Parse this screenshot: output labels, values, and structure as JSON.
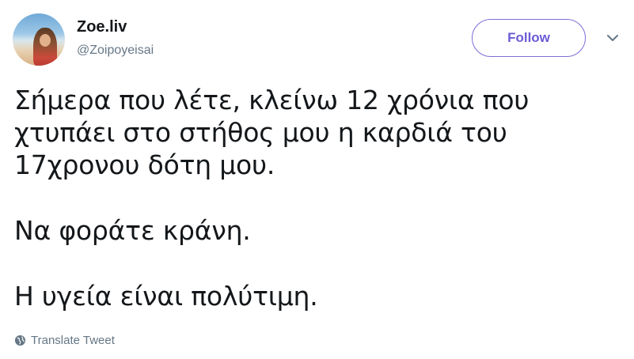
{
  "author": {
    "name": "Zoe.liv",
    "handle": "@Zoipoyeisai"
  },
  "follow_button": {
    "label": "Follow"
  },
  "menu_caret": {
    "icon": "chevron-down-icon"
  },
  "tweet": {
    "lines": [
      "Σήμερα που λέτε, κλείνω 12 χρόνια που",
      "χτυπάει στο στήθος μου η καρδιά του",
      "17χρονου δότη μου."
    ],
    "line2": "Να φοράτε κράνη.",
    "line3": "Η υγεία είναι πολύτιμη."
  },
  "translate": {
    "icon": "globe-icon",
    "label": "Translate Tweet"
  },
  "colors": {
    "text": "#14171a",
    "secondary": "#657786",
    "follow_accent": "#6b5bd6"
  }
}
